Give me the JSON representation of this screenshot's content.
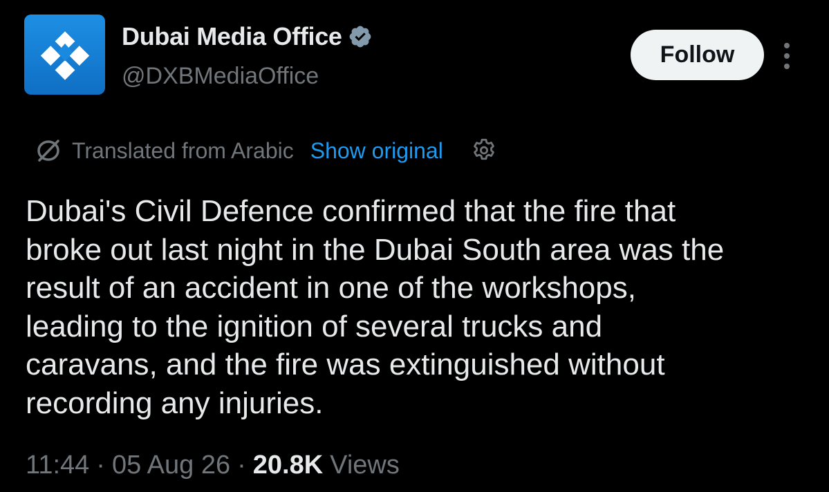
{
  "author": {
    "display_name": "Dubai Media Office",
    "handle": "@DXBMediaOffice",
    "avatar_icon": "dubai-media-office-logo",
    "verified_icon": "verified-badge-icon",
    "brand_color": "#1a8ae0"
  },
  "actions": {
    "follow_label": "Follow",
    "more_icon": "more-options-icon"
  },
  "translation": {
    "icon": "translate-icon",
    "label": "Translated from Arabic",
    "show_original_label": "Show original",
    "settings_icon": "gear-icon",
    "link_color": "#1d9bf0"
  },
  "tweet": {
    "text": "Dubai's Civil Defence confirmed that the fire that\nbroke out last night in the Dubai South area was the\nresult of an accident in one of the workshops,\nleading to the ignition of several trucks and\ncaravans, and the fire was extinguished without\nrecording any injuries."
  },
  "meta": {
    "time": "11:44",
    "separator": "·",
    "date": "05 Aug 26",
    "views_count": "20.8K",
    "views_label": "Views"
  }
}
